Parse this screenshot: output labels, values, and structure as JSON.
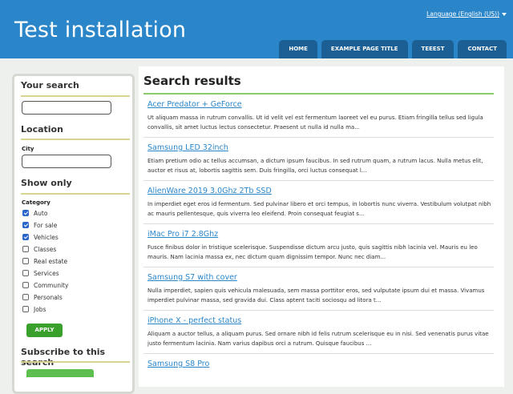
{
  "header": {
    "site_title": "Test installation",
    "language_label": "Language (English (US))",
    "nav": [
      "HOME",
      "EXAMPLE PAGE TITLE",
      "TEEEST",
      "CONTACT"
    ]
  },
  "sidebar": {
    "search_heading": "Your search",
    "search_value": "",
    "location_heading": "Location",
    "city_label": "City",
    "city_value": "",
    "show_only_heading": "Show only",
    "category_label": "Category",
    "categories": [
      {
        "label": "Auto",
        "checked": true
      },
      {
        "label": "For sale",
        "checked": true
      },
      {
        "label": "Vehicles",
        "checked": true
      },
      {
        "label": "Classes",
        "checked": false
      },
      {
        "label": "Real estate",
        "checked": false
      },
      {
        "label": "Services",
        "checked": false
      },
      {
        "label": "Community",
        "checked": false
      },
      {
        "label": "Personals",
        "checked": false
      },
      {
        "label": "Jobs",
        "checked": false
      }
    ],
    "apply_label": "APPLY",
    "subscribe_heading": "Subscribe to this search"
  },
  "main": {
    "title": "Search results",
    "results": [
      {
        "title": "Acer Predator + GeForce",
        "desc": "Ut aliquam massa in rutrum convallis. Ut id velit vel est fermentum laoreet vel eu purus. Etiam fringilla tellus sed ligula convallis, sit amet luctus lectus consectetur. Praesent ut nulla id nulla ma..."
      },
      {
        "title": "Samsung LED 32inch",
        "desc": "Etiam pretium odio ac tellus accumsan, a dictum ipsum faucibus. In sed rutrum quam, a rutrum lacus. Nulla metus elit, auctor et risus at, lobortis sagittis sem. Duis fringilla, orci luctus consequat l..."
      },
      {
        "title": "AlienWare 2019 3.0Ghz 2Tb SSD",
        "desc": "In imperdiet eget eros id fermentum. Sed pulvinar libero et orci tempus, in lobortis nunc viverra. Vestibulum volutpat nibh ac mauris pellentesque, quis viverra leo eleifend. Proin consequat feugiat s..."
      },
      {
        "title": "iMac Pro i7 2.8Ghz",
        "desc": "Fusce finibus dolor in tristique scelerisque. Suspendisse dictum arcu justo, quis sagittis nibh lacinia vel. Mauris eu leo mauris. Nam lacinia massa ex, nec dictum quam dignissim tempor. Nunc nec diam..."
      },
      {
        "title": "Samsung S7 with cover",
        "desc": "Nulla imperdiet, sapien quis vehicula malesuada, sem massa porttitor eros, sed vulputate ipsum dui et massa. Vivamus imperdiet pulvinar massa, sed gravida dui. Class aptent taciti sociosqu ad litora t..."
      },
      {
        "title": "iPhone X - perfect status",
        "desc": "Aliquam a auctor tellus, a aliquam purus. Sed ornare nibh id felis rutrum scelerisque eu in nisi. Sed venenatis purus vitae justo fermentum lacinia. Nam varius dapibus orci a rutrum. Quisque faucibus ..."
      },
      {
        "title": "Samsung S8 Pro",
        "desc": ""
      }
    ]
  },
  "colors": {
    "header_bg": "#2a86c9",
    "nav_tab_bg": "#1b5f95",
    "link": "#2a86c9",
    "apply_button": "#3aa02c",
    "heading_rule": "#d8d48f",
    "results_rule": "#8acb6c"
  }
}
